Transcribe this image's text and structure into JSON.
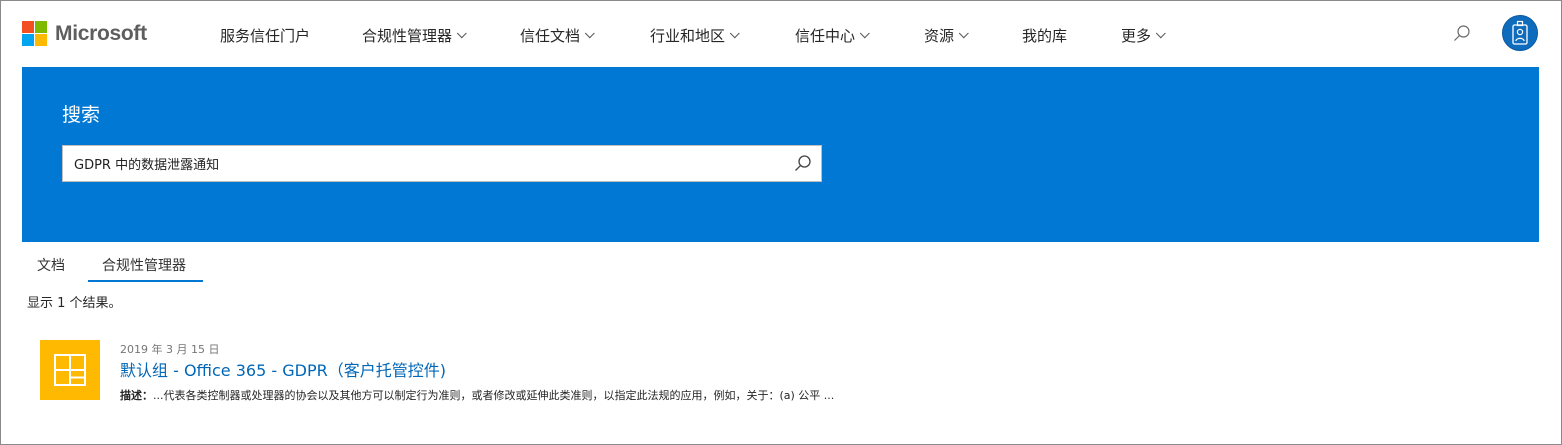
{
  "brand": {
    "name": "Microsoft",
    "logo_colors": [
      "#f25022",
      "#7fba00",
      "#00a4ef",
      "#ffb900"
    ]
  },
  "nav": {
    "items": [
      {
        "label": "服务信任门户",
        "has_dropdown": false
      },
      {
        "label": "合规性管理器",
        "has_dropdown": true
      },
      {
        "label": "信任文档",
        "has_dropdown": true
      },
      {
        "label": "行业和地区",
        "has_dropdown": true
      },
      {
        "label": "信任中心",
        "has_dropdown": true
      },
      {
        "label": "资源",
        "has_dropdown": true
      },
      {
        "label": "我的库",
        "has_dropdown": false
      },
      {
        "label": "更多",
        "has_dropdown": true
      }
    ]
  },
  "hero": {
    "title": "搜索",
    "search_value": "GDPR 中的数据泄露通知",
    "background": "#0078d4"
  },
  "tabs": [
    {
      "label": "文档",
      "active": false
    },
    {
      "label": "合规性管理器",
      "active": true
    }
  ],
  "results": {
    "count_text": "显示 1 个结果。",
    "items": [
      {
        "date": "2019 年 3 月 15 日",
        "title": "默认组 - Office 365 - GDPR（客户托管控件)",
        "desc_label": "描述：",
        "desc_text": "...代表各类控制器或处理器的协会以及其他方可以制定行为准则，或者修改或延伸此类准则，以指定此法规的应用，例如，关于：(a) 公平 ...",
        "tile_color": "#ffb900",
        "icon": "layout-grid-icon"
      }
    ]
  },
  "colors": {
    "accent": "#0078d4",
    "link": "#0067b8"
  }
}
